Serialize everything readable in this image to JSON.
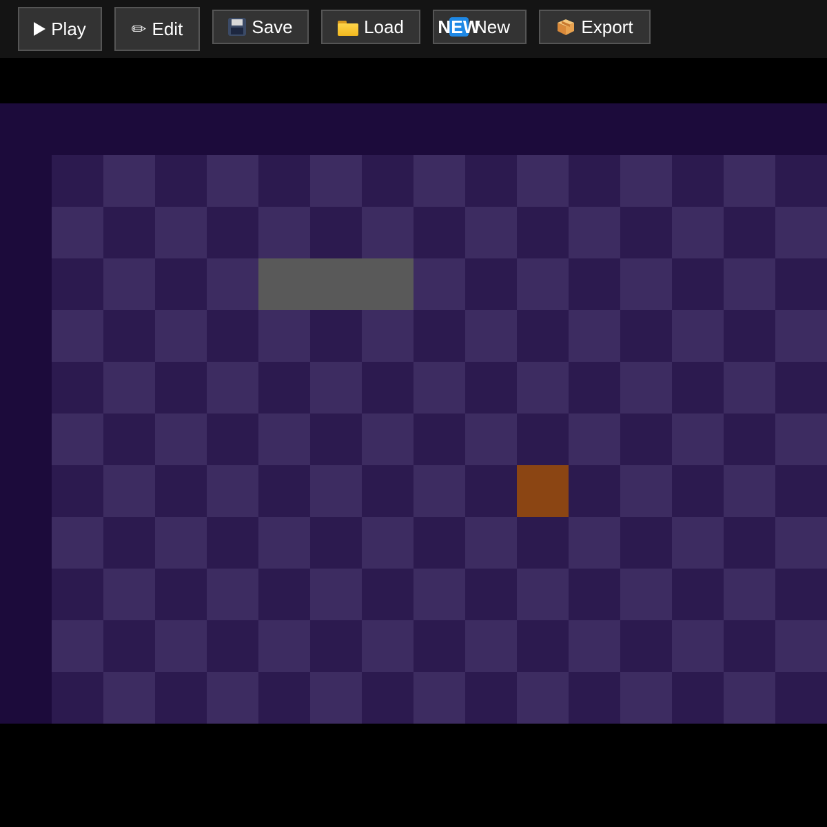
{
  "toolbar": {
    "buttons": [
      {
        "id": "play",
        "label": "Play",
        "icon": "play-icon"
      },
      {
        "id": "edit",
        "label": "Edit",
        "icon": "pencil-icon"
      },
      {
        "id": "save",
        "label": "Save",
        "icon": "floppy-disk-icon"
      },
      {
        "id": "load",
        "label": "Load",
        "icon": "folder-icon"
      },
      {
        "id": "new",
        "label": "New",
        "icon": "new-badge-icon",
        "icon_text": "NEW"
      },
      {
        "id": "export",
        "label": "Export",
        "icon": "package-icon"
      }
    ]
  },
  "board": {
    "columns": 15,
    "rows": 11,
    "colors": {
      "background": "#1c0b3b",
      "cell_dark": "#2c1a4f",
      "cell_light": "#3d2c61",
      "wall": "#595959",
      "block": "#8b4513"
    },
    "tiles": [
      {
        "type": "wall",
        "col": 4,
        "row": 2,
        "width_cells": 3,
        "height_cells": 1
      },
      {
        "type": "block",
        "col": 9,
        "row": 6,
        "width_cells": 1,
        "height_cells": 1
      }
    ]
  }
}
